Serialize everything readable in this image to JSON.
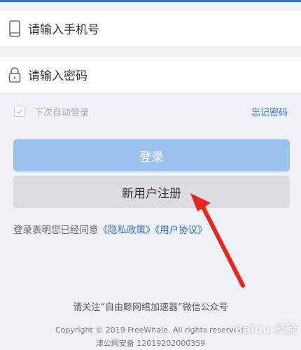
{
  "phone_field": {
    "placeholder": "请输入手机号",
    "icon": "phone-icon"
  },
  "password_field": {
    "placeholder": "请输入密码",
    "icon": "lock-icon"
  },
  "remember": {
    "label": "下次自动登录",
    "checked": true
  },
  "forgot_password": "忘记密码",
  "login_button": "登录",
  "register_button": "新用户注册",
  "agreement": {
    "prefix": "登录表明您已经同意",
    "privacy_link": "《隐私政策》",
    "user_agreement_link": "《用户协议》"
  },
  "follow_notice": "请关注“自由鲸网络加速器”微信公众号",
  "copyright": "Copyright © 2019 FreeWhale. All rights reserved.",
  "icp": "津公网安备 12019202000359",
  "colors": {
    "accent": "#2f74d0",
    "login_button_bg": "#9cc3ef",
    "register_button_bg": "#dcdde0",
    "page_bg": "#eef1f5",
    "annotation_arrow": "#e8261f"
  }
}
